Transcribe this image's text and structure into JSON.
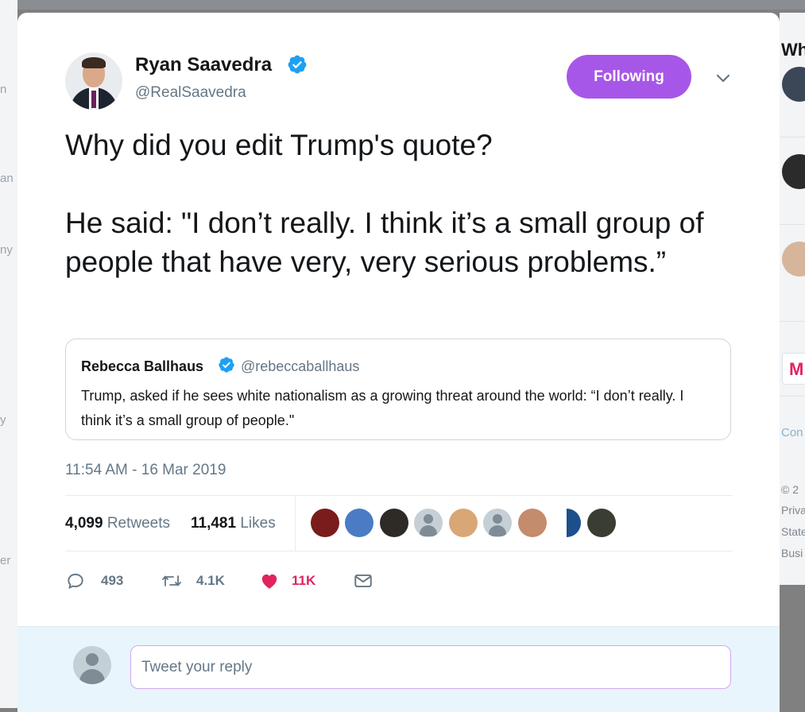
{
  "background": {
    "left_fragments": [
      "n",
      "an",
      "ny",
      "y",
      "er"
    ],
    "right_header": "Wh",
    "right_link": "Con",
    "right_footer": [
      "© 2",
      "Priva",
      "State",
      "Busi"
    ],
    "right_m": "M"
  },
  "tweet": {
    "author_name": "Ryan Saavedra",
    "author_handle": "@RealSaavedra",
    "follow_label": "Following",
    "text": "Why did you edit Trump's quote?\n\nHe said: \"I don’t really. I think it’s a small group of people that have very, very serious problems.”",
    "timestamp": "11:54 AM - 16 Mar 2019"
  },
  "quote": {
    "author_name": "Rebecca Ballhaus",
    "author_handle": "@rebeccaballhaus",
    "text": "Trump, asked if he sees white nationalism as a growing threat around the world: “I don’t really. I think it’s a small group of people.\""
  },
  "stats": {
    "retweets_count": "4,099",
    "retweets_label": "Retweets",
    "likes_count": "11,481",
    "likes_label": "Likes"
  },
  "actions": {
    "replies": "493",
    "retweets": "4.1K",
    "likes": "11K"
  },
  "reply": {
    "placeholder": "Tweet your reply"
  },
  "colors": {
    "follow_button": "#a757e8",
    "verified": "#1da1f2",
    "like": "#e0245e",
    "muted": "#657786"
  }
}
